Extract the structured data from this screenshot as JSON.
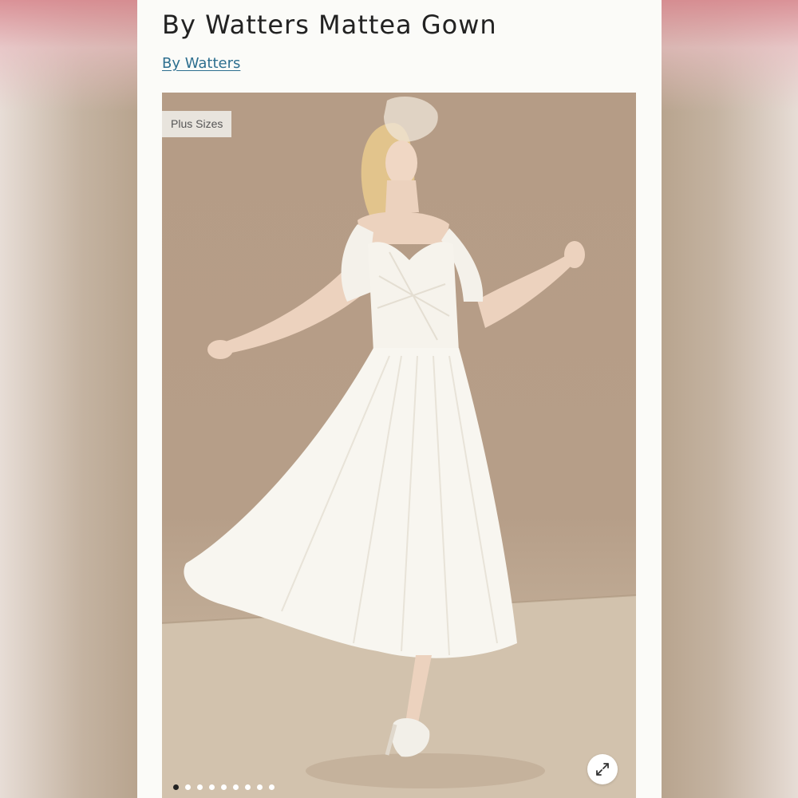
{
  "product": {
    "title": "By Watters Mattea Gown",
    "brand": "By Watters"
  },
  "gallery": {
    "badge": "Plus Sizes",
    "image_count": 9,
    "active_index": 0,
    "expand_icon": "expand-icon"
  },
  "colors": {
    "link": "#2d6f8f",
    "title": "#222222",
    "photo_background": "#b59c86"
  }
}
